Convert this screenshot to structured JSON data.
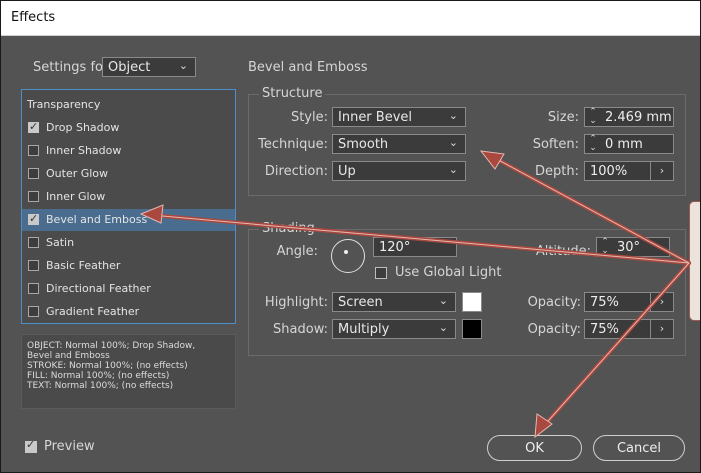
{
  "window": {
    "title": "Effects"
  },
  "settings_for": {
    "label": "Settings for:",
    "value": "Object"
  },
  "effects_list": [
    {
      "label": "Transparency",
      "checkbox": false,
      "checked": false,
      "selected": false
    },
    {
      "label": "Drop Shadow",
      "checkbox": true,
      "checked": true,
      "selected": false
    },
    {
      "label": "Inner Shadow",
      "checkbox": true,
      "checked": false,
      "selected": false
    },
    {
      "label": "Outer Glow",
      "checkbox": true,
      "checked": false,
      "selected": false
    },
    {
      "label": "Inner Glow",
      "checkbox": true,
      "checked": false,
      "selected": false
    },
    {
      "label": "Bevel and Emboss",
      "checkbox": true,
      "checked": true,
      "selected": true
    },
    {
      "label": "Satin",
      "checkbox": true,
      "checked": false,
      "selected": false
    },
    {
      "label": "Basic Feather",
      "checkbox": true,
      "checked": false,
      "selected": false
    },
    {
      "label": "Directional Feather",
      "checkbox": true,
      "checked": false,
      "selected": false
    },
    {
      "label": "Gradient Feather",
      "checkbox": true,
      "checked": false,
      "selected": false
    }
  ],
  "summary": [
    "OBJECT: Normal 100%; Drop Shadow,",
    "Bevel and Emboss",
    "STROKE: Normal 100%; (no effects)",
    "FILL: Normal 100%; (no effects)",
    "TEXT: Normal 100%; (no effects)"
  ],
  "panel": {
    "title": "Bevel and Emboss"
  },
  "structure": {
    "title": "Structure",
    "style_label": "Style:",
    "style_value": "Inner Bevel",
    "technique_label": "Technique:",
    "technique_value": "Smooth",
    "direction_label": "Direction:",
    "direction_value": "Up",
    "size_label": "Size:",
    "size_value": "2.469 mm",
    "soften_label": "Soften:",
    "soften_value": "0 mm",
    "depth_label": "Depth:",
    "depth_value": "100%"
  },
  "shading": {
    "title": "Shading",
    "angle_label": "Angle:",
    "angle_value": "120°",
    "altitude_label": "Altitude:",
    "altitude_value": "30°",
    "use_global_light": "Use Global Light",
    "highlight_label": "Highlight:",
    "highlight_value": "Screen",
    "highlight_color": "#ffffff",
    "highlight_opacity_label": "Opacity:",
    "highlight_opacity_value": "75%",
    "shadow_label": "Shadow:",
    "shadow_value": "Multiply",
    "shadow_color": "#000000",
    "shadow_opacity_label": "Opacity:",
    "shadow_opacity_value": "75%"
  },
  "footer": {
    "preview_label": "Preview",
    "ok_label": "OK",
    "cancel_label": "Cancel"
  },
  "colors": {
    "dialog_bg": "#535353",
    "accent": "#4c8fc9",
    "annotation_arrow": "#a8483f"
  }
}
